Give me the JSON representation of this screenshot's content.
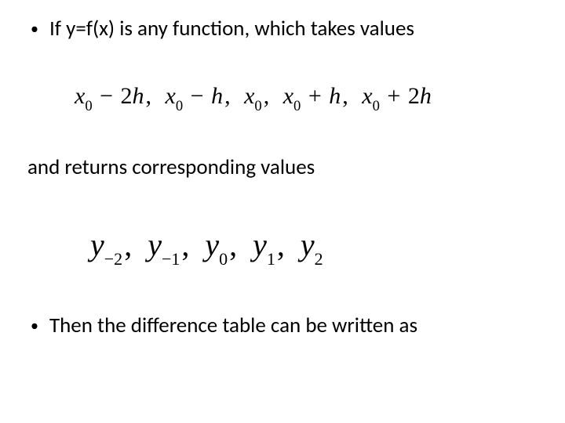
{
  "bullets": {
    "item1": "If  y=f(x)  is any function, which takes values",
    "item2": "Then the difference table can be written as"
  },
  "continuation": "and returns corresponding values",
  "math_row1": {
    "t1_var": "x",
    "t1_sub": "0",
    "t1_op": "−",
    "t1_rhs_num": "2",
    "t1_rhs_var": "h",
    "t2_var": "x",
    "t2_sub": "0",
    "t2_op": "−",
    "t2_rhs_var": "h",
    "t3_var": "x",
    "t3_sub": "0",
    "t4_var": "x",
    "t4_sub": "0",
    "t4_op": "+",
    "t4_rhs_var": "h",
    "t5_var": "x",
    "t5_sub": "0",
    "t5_op": "+",
    "t5_rhs_num": "2",
    "t5_rhs_var": "h",
    "comma": ","
  },
  "math_row2": {
    "y1_var": "y",
    "y1_sub": "−2",
    "y2_var": "y",
    "y2_sub": "−1",
    "y3_var": "y",
    "y3_sub": "0",
    "y4_var": "y",
    "y4_sub": "1",
    "y5_var": "y",
    "y5_sub": "2",
    "comma": ","
  }
}
